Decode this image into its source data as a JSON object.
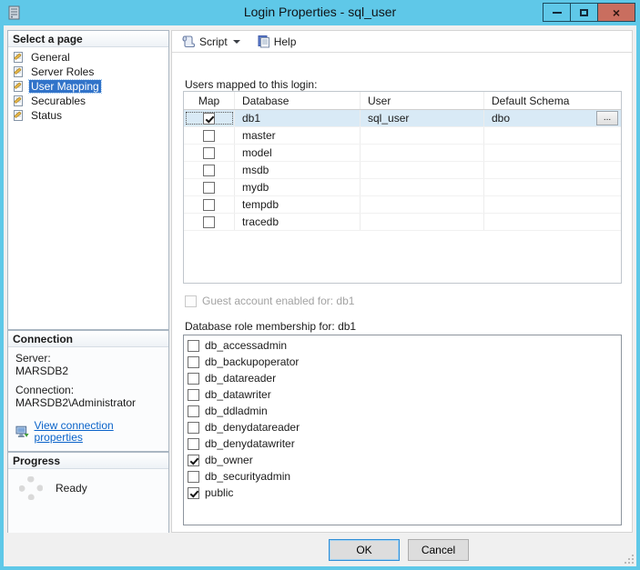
{
  "window": {
    "title": "Login Properties - sql_user",
    "controls": {
      "minimize": "minimize",
      "maximize": "maximize",
      "close": "close"
    }
  },
  "colors": {
    "titlebar": "#5fc8e8",
    "close_button": "#c96e5f",
    "selection_blue": "#3173c9",
    "row_highlight": "#d9eaf6",
    "link": "#0a63c9"
  },
  "sidebar": {
    "select_page": {
      "header": "Select a page",
      "items": [
        {
          "label": "General",
          "selected": false
        },
        {
          "label": "Server Roles",
          "selected": false
        },
        {
          "label": "User Mapping",
          "selected": true
        },
        {
          "label": "Securables",
          "selected": false
        },
        {
          "label": "Status",
          "selected": false
        }
      ]
    },
    "connection": {
      "header": "Connection",
      "server_label": "Server:",
      "server_value": "MARSDB2",
      "connection_label": "Connection:",
      "connection_value": "MARSDB2\\Administrator",
      "link_label": "View connection properties"
    },
    "progress": {
      "header": "Progress",
      "status": "Ready"
    }
  },
  "toolbar": {
    "script_label": "Script",
    "help_label": "Help"
  },
  "main": {
    "users_mapped_label": "Users mapped to this login:",
    "table": {
      "columns": [
        "Map",
        "Database",
        "User",
        "Default Schema"
      ],
      "browse_label": "...",
      "rows": [
        {
          "checked": true,
          "database": "db1",
          "user": "sql_user",
          "default_schema": "dbo",
          "selected": true,
          "browse": true
        },
        {
          "checked": false,
          "database": "master",
          "user": "",
          "default_schema": "",
          "selected": false,
          "browse": false
        },
        {
          "checked": false,
          "database": "model",
          "user": "",
          "default_schema": "",
          "selected": false,
          "browse": false
        },
        {
          "checked": false,
          "database": "msdb",
          "user": "",
          "default_schema": "",
          "selected": false,
          "browse": false
        },
        {
          "checked": false,
          "database": "mydb",
          "user": "",
          "default_schema": "",
          "selected": false,
          "browse": false
        },
        {
          "checked": false,
          "database": "tempdb",
          "user": "",
          "default_schema": "",
          "selected": false,
          "browse": false
        },
        {
          "checked": false,
          "database": "tracedb",
          "user": "",
          "default_schema": "",
          "selected": false,
          "browse": false
        }
      ]
    },
    "guest_checkbox_label": "Guest account enabled for: db1",
    "role_membership_label": "Database role membership for: db1",
    "roles": [
      {
        "name": "db_accessadmin",
        "checked": false
      },
      {
        "name": "db_backupoperator",
        "checked": false
      },
      {
        "name": "db_datareader",
        "checked": false
      },
      {
        "name": "db_datawriter",
        "checked": false
      },
      {
        "name": "db_ddladmin",
        "checked": false
      },
      {
        "name": "db_denydatareader",
        "checked": false
      },
      {
        "name": "db_denydatawriter",
        "checked": false
      },
      {
        "name": "db_owner",
        "checked": true
      },
      {
        "name": "db_securityadmin",
        "checked": false
      },
      {
        "name": "public",
        "checked": true
      }
    ]
  },
  "footer": {
    "ok_label": "OK",
    "cancel_label": "Cancel"
  }
}
